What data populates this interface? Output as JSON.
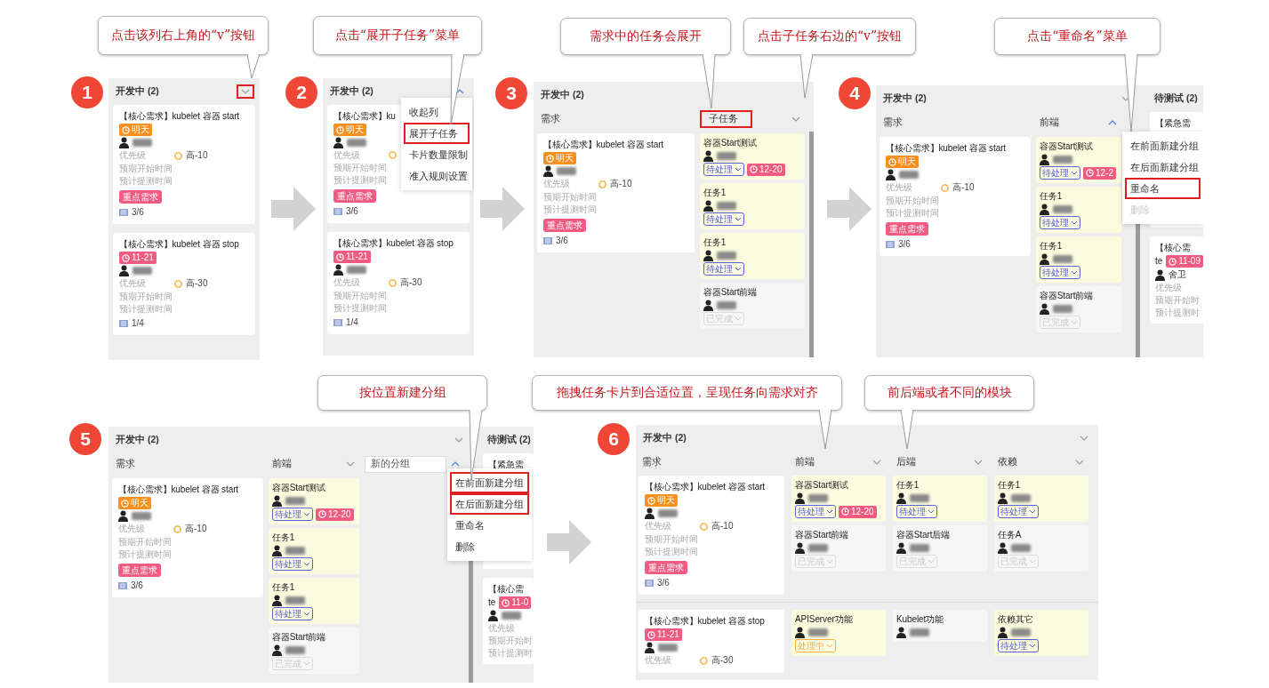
{
  "steps": [
    {
      "number": "1",
      "callouts": [
        {
          "text": "点击该列右上角的“v”按钮"
        }
      ],
      "board": {
        "columns": [
          {
            "kind": "list",
            "title": "开发中 (2)",
            "toggle": {
              "expanded": false,
              "highlighted": true
            },
            "cards": [
              {
                "title": "【核心需求】kubelet 容器 start",
                "due": {
                  "text": "明天",
                  "kind": "soon"
                },
                "priority_label": "优先级",
                "priority": "高-10",
                "start_label": "预期开始时间",
                "test_label": "预计提测时间",
                "tag": "重点需求",
                "progress": "3/6"
              },
              {
                "title": "【核心需求】kubelet 容器 stop",
                "due": {
                  "text": "11-21",
                  "kind": "overdue"
                },
                "priority_label": "优先级",
                "priority": "高-30",
                "start_label": "预期开始时间",
                "test_label": "预计提测时间",
                "progress": "1/4"
              }
            ]
          }
        ]
      }
    },
    {
      "number": "2",
      "callouts": [
        {
          "text": "点击“展开子任务”菜单"
        }
      ],
      "board": {
        "columns": [
          {
            "kind": "list",
            "title": "开发中 (2)",
            "toggle": {
              "expanded": true,
              "highlighted": false
            },
            "cards": [
              {
                "title": "【核心需求】ku",
                "due": {
                  "text": "明天",
                  "kind": "soon"
                },
                "priority_label": "优先级",
                "start_label": "预期开始时间",
                "test_label": "预计提测时间",
                "tag": "重点需求",
                "progress": "3/6"
              },
              {
                "title": "【核心需求】kubelet 容器 stop",
                "due": {
                  "text": "11-21",
                  "kind": "overdue"
                },
                "priority_label": "优先级",
                "priority": "高-30",
                "start_label": "预期开始时间",
                "test_label": "预计提测时间",
                "progress": "1/4"
              }
            ]
          }
        ],
        "menu": {
          "items": [
            {
              "label": "收起列",
              "highlighted": false,
              "disabled": false
            },
            {
              "label": "展开子任务",
              "highlighted": true,
              "disabled": false
            },
            {
              "label": "卡片数量限制",
              "highlighted": false,
              "disabled": false
            },
            {
              "label": "准入规则设置",
              "highlighted": false,
              "disabled": false
            }
          ]
        }
      }
    },
    {
      "number": "3",
      "callouts": [
        {
          "text": "需求中的任务会展开"
        },
        {
          "text": "点击子任务右边的“v”按钮"
        }
      ],
      "board": {
        "columns": [
          {
            "kind": "swimlane",
            "title": "开发中 (2)",
            "lanes": [
              {
                "kind": "label",
                "title": "需求",
                "highlighted": false
              },
              {
                "kind": "label",
                "title": "子任务",
                "highlighted": true,
                "toggle": {
                  "expanded": false,
                  "highlighted": false
                }
              }
            ],
            "rows": [
              {
                "requirement": {
                  "title": "【核心需求】kubelet 容器 start",
                  "due": {
                    "text": "明天",
                    "kind": "soon"
                  },
                  "priority_label": "优先级",
                  "priority": "高-10",
                  "start_label": "预期开始时间",
                  "test_label": "预计提测时间",
                  "tag": "重点需求",
                  "progress": "3/6"
                },
                "groups": [
                  {
                    "cards": [
                      {
                        "title": "容器Start测试",
                        "done": false,
                        "status": {
                          "text": "待处理",
                          "kind": "todo"
                        },
                        "due": {
                          "text": "12-20",
                          "kind": "overdue"
                        }
                      },
                      {
                        "title": "任务1",
                        "done": false,
                        "status": {
                          "text": "待处理",
                          "kind": "todo"
                        }
                      },
                      {
                        "title": "任务1",
                        "done": false,
                        "status": {
                          "text": "待处理",
                          "kind": "todo"
                        }
                      },
                      {
                        "title": "容器Start前端",
                        "done": true,
                        "status": {
                          "text": "已完成",
                          "kind": "done"
                        }
                      }
                    ]
                  }
                ]
              }
            ]
          }
        ]
      }
    },
    {
      "number": "4",
      "callouts": [
        {
          "text": "点击“重命名”菜单"
        }
      ],
      "board": {
        "columns": [
          {
            "kind": "swimlane",
            "title": "开发中 (2)",
            "toggle": {
              "expanded": false,
              "highlighted": false
            },
            "lanes": [
              {
                "kind": "label",
                "title": "需求",
                "highlighted": false
              },
              {
                "kind": "label",
                "title": "前端",
                "highlighted": false,
                "toggle": {
                  "expanded": true,
                  "highlighted": false
                }
              }
            ],
            "rows": [
              {
                "requirement": {
                  "title": "【核心需求】kubelet 容器 start",
                  "due": {
                    "text": "明天",
                    "kind": "soon"
                  },
                  "priority_label": "优先级",
                  "priority": "高-10",
                  "start_label": "预期开始时间",
                  "test_label": "预计提测时间",
                  "tag": "重点需求",
                  "progress": "3/6"
                },
                "groups": [
                  {
                    "cards": [
                      {
                        "title": "容器Start测试",
                        "done": false,
                        "status": {
                          "text": "待处理",
                          "kind": "todo"
                        },
                        "due": {
                          "text": "12-2",
                          "kind": "overdue"
                        }
                      },
                      {
                        "title": "任务1",
                        "done": false,
                        "status": {
                          "text": "待处理",
                          "kind": "todo"
                        }
                      },
                      {
                        "title": "任务1",
                        "done": false,
                        "status": {
                          "text": "待处理",
                          "kind": "todo"
                        }
                      },
                      {
                        "title": "容器Start前端",
                        "done": true,
                        "status": {
                          "text": "已完成",
                          "kind": "done"
                        }
                      }
                    ]
                  }
                ]
              }
            ]
          },
          {
            "kind": "list",
            "title": "待测试 (2)",
            "cards": [
              {
                "title": "【紧急需"
              },
              {
                "title": "【核心需",
                "title_end": "te",
                "due": {
                  "text": "11-09",
                  "kind": "overdue"
                },
                "assignee": "舍卫",
                "priority_label": "优先级",
                "start_label": "预期开始时",
                "test_label": "预计提测时"
              }
            ]
          }
        ],
        "menu": {
          "items": [
            {
              "label": "在前面新建分组",
              "highlighted": false,
              "disabled": false
            },
            {
              "label": "在后面新建分组",
              "highlighted": false,
              "disabled": false
            },
            {
              "label": "重命名",
              "highlighted": true,
              "disabled": false
            },
            {
              "label": "删除",
              "highlighted": false,
              "disabled": true
            }
          ]
        }
      }
    },
    {
      "number": "5",
      "callouts": [
        {
          "text": "按位置新建分组"
        }
      ],
      "board": {
        "columns": [
          {
            "kind": "swimlane",
            "title": "开发中 (2)",
            "toggle": {
              "expanded": false,
              "highlighted": false
            },
            "lanes": [
              {
                "kind": "label",
                "title": "需求",
                "highlighted": false
              },
              {
                "kind": "label",
                "title": "前端",
                "highlighted": false,
                "toggle": {
                  "expanded": false,
                  "highlighted": false
                }
              },
              {
                "kind": "input",
                "value": "新的分组",
                "highlighted": false,
                "toggle": {
                  "expanded": true,
                  "highlighted": false
                }
              }
            ],
            "rows": [
              {
                "requirement": {
                  "title": "【核心需求】kubelet 容器 start",
                  "due": {
                    "text": "明天",
                    "kind": "soon"
                  },
                  "priority_label": "优先级",
                  "priority": "高-10",
                  "start_label": "预期开始时间",
                  "test_label": "预计提测时间",
                  "tag": "重点需求",
                  "progress": "3/6"
                },
                "groups": [
                  {
                    "cards": [
                      {
                        "title": "容器Start测试",
                        "done": false,
                        "status": {
                          "text": "待处理",
                          "kind": "todo"
                        },
                        "due": {
                          "text": "12-20",
                          "kind": "overdue"
                        }
                      },
                      {
                        "title": "任务1",
                        "done": false,
                        "status": {
                          "text": "待处理",
                          "kind": "todo"
                        }
                      },
                      {
                        "title": "任务1",
                        "done": false,
                        "status": {
                          "text": "待处理",
                          "kind": "todo"
                        }
                      },
                      {
                        "title": "容器Start前端",
                        "done": true,
                        "status": {
                          "text": "已完成",
                          "kind": "done"
                        }
                      }
                    ]
                  }
                ]
              }
            ]
          },
          {
            "kind": "list",
            "title": "待测试 (2)",
            "cards": [
              {
                "title": "【紧急需"
              },
              {
                "title": "【核心需",
                "title_end": "te",
                "due": {
                  "text": "11-0",
                  "kind": "overdue"
                },
                "priority_label": "优先级",
                "start_label": "预期开始时",
                "test_label": "预计提测时"
              }
            ]
          }
        ],
        "menu": {
          "items": [
            {
              "label": "在前面新建分组",
              "highlighted": true,
              "disabled": false
            },
            {
              "label": "在后面新建分组",
              "highlighted": true,
              "disabled": false
            },
            {
              "label": "重命名",
              "highlighted": false,
              "disabled": false
            },
            {
              "label": "删除",
              "highlighted": false,
              "disabled": false
            }
          ]
        }
      }
    },
    {
      "number": "6",
      "callouts": [
        {
          "text": "拖拽任务卡片到合适位置，呈现任务向需求对齐"
        },
        {
          "text": "前后端或者不同的模块"
        }
      ],
      "board": {
        "columns": [
          {
            "kind": "swimlane",
            "title": "开发中 (2)",
            "toggle": {
              "expanded": false,
              "highlighted": false
            },
            "lanes": [
              {
                "kind": "label",
                "title": "需求",
                "highlighted": false
              },
              {
                "kind": "label",
                "title": "前端",
                "highlighted": false,
                "toggle": {
                  "expanded": false,
                  "highlighted": false
                }
              },
              {
                "kind": "label",
                "title": "后端",
                "highlighted": false,
                "toggle": {
                  "expanded": false,
                  "highlighted": false
                }
              },
              {
                "kind": "label",
                "title": "依赖",
                "highlighted": false,
                "toggle": {
                  "expanded": false,
                  "highlighted": false
                }
              }
            ],
            "rows": [
              {
                "requirement": {
                  "title": "【核心需求】kubelet 容器 start",
                  "due": {
                    "text": "明天",
                    "kind": "soon"
                  },
                  "priority_label": "优先级",
                  "priority": "高-10",
                  "start_label": "预期开始时间",
                  "test_label": "预计提测时间",
                  "tag": "重点需求",
                  "progress": "3/6"
                },
                "groups": [
                  {
                    "cards": [
                      {
                        "title": "容器Start测试",
                        "done": false,
                        "status": {
                          "text": "待处理",
                          "kind": "todo"
                        },
                        "due": {
                          "text": "12-20",
                          "kind": "overdue"
                        }
                      },
                      {
                        "title": "容器Start前端",
                        "done": true,
                        "status": {
                          "text": "已完成",
                          "kind": "done"
                        }
                      }
                    ]
                  },
                  {
                    "cards": [
                      {
                        "title": "任务1",
                        "done": false,
                        "status": {
                          "text": "待处理",
                          "kind": "todo"
                        }
                      },
                      {
                        "title": "容器Start后端",
                        "done": true,
                        "status": {
                          "text": "已完成",
                          "kind": "done"
                        }
                      }
                    ]
                  },
                  {
                    "cards": [
                      {
                        "title": "任务1",
                        "done": false,
                        "status": {
                          "text": "待处理",
                          "kind": "todo"
                        }
                      },
                      {
                        "title": "任务A",
                        "done": true,
                        "status": {
                          "text": "已完成",
                          "kind": "done"
                        }
                      }
                    ]
                  }
                ]
              },
              {
                "requirement": {
                  "title": "【核心需求】kubelet 容器 stop",
                  "due": {
                    "text": "11-21",
                    "kind": "overdue"
                  },
                  "priority_label": "优先级",
                  "priority": "高-30"
                },
                "groups": [
                  {
                    "cards": [
                      {
                        "title": "APIServer功能",
                        "done": false,
                        "status": {
                          "text": "处理中",
                          "kind": "doing"
                        }
                      }
                    ]
                  },
                  {
                    "cards": [
                      {
                        "title": "Kubelet功能",
                        "done": true
                      }
                    ]
                  },
                  {
                    "cards": [
                      {
                        "title": "依赖其它",
                        "done": false,
                        "status": {
                          "text": "待处理",
                          "kind": "todo"
                        }
                      }
                    ]
                  }
                ]
              }
            ]
          }
        ]
      }
    }
  ]
}
